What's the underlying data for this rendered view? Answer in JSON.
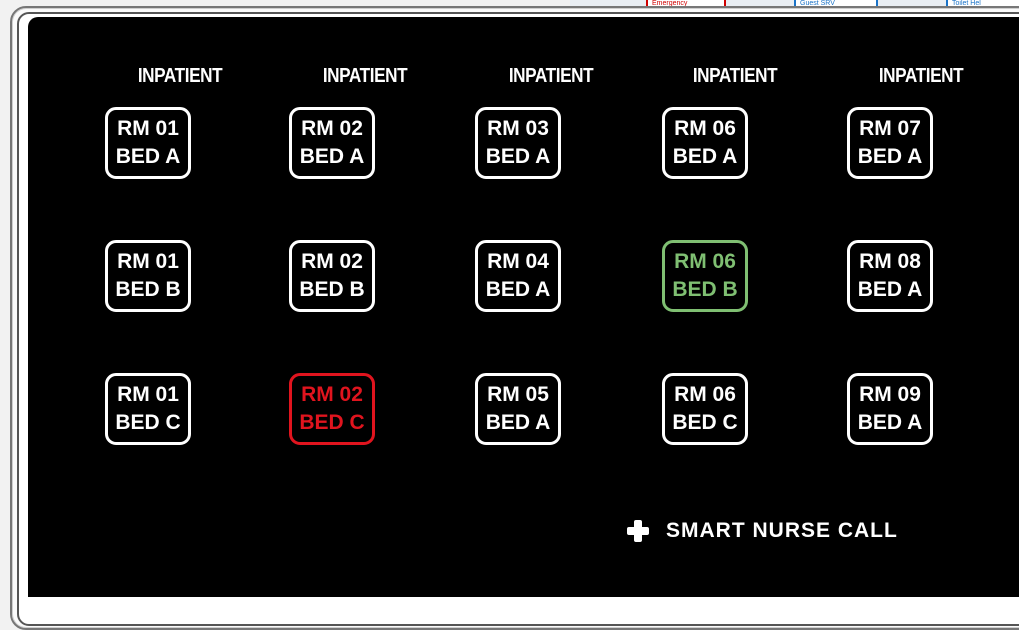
{
  "background_window": {
    "tabs": [
      "Emergency",
      "Guest SRV",
      "Toilet Hel"
    ]
  },
  "columns": [
    {
      "header": "INPATIENT"
    },
    {
      "header": "INPATIENT"
    },
    {
      "header": "INPATIENT"
    },
    {
      "header": "INPATIENT"
    },
    {
      "header": "INPATIENT"
    }
  ],
  "beds": [
    [
      {
        "room": "RM 01",
        "bed": "BED A",
        "status": "normal"
      },
      {
        "room": "RM 01",
        "bed": "BED B",
        "status": "normal"
      },
      {
        "room": "RM 01",
        "bed": "BED C",
        "status": "normal"
      }
    ],
    [
      {
        "room": "RM 02",
        "bed": "BED A",
        "status": "normal"
      },
      {
        "room": "RM 02",
        "bed": "BED B",
        "status": "normal"
      },
      {
        "room": "RM 02",
        "bed": "BED C",
        "status": "alert"
      }
    ],
    [
      {
        "room": "RM 03",
        "bed": "BED A",
        "status": "normal"
      },
      {
        "room": "RM 04",
        "bed": "BED A",
        "status": "normal"
      },
      {
        "room": "RM 05",
        "bed": "BED A",
        "status": "normal"
      }
    ],
    [
      {
        "room": "RM 06",
        "bed": "BED A",
        "status": "normal"
      },
      {
        "room": "RM 06",
        "bed": "BED B",
        "status": "ok"
      },
      {
        "room": "RM 06",
        "bed": "BED C",
        "status": "normal"
      }
    ],
    [
      {
        "room": "RM 07",
        "bed": "BED A",
        "status": "normal"
      },
      {
        "room": "RM 08",
        "bed": "BED A",
        "status": "normal"
      },
      {
        "room": "RM 09",
        "bed": "BED A",
        "status": "normal"
      }
    ]
  ],
  "colors": {
    "background": "#000000",
    "normal": "#ffffff",
    "alert": "#e0141e",
    "ok": "#7fbf72"
  },
  "brand": {
    "icon": "cross-icon",
    "text": "SMART NURSE CALL"
  }
}
